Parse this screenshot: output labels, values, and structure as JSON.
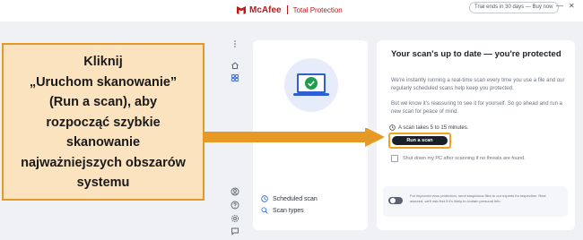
{
  "app": {
    "brand_name": "McAfee",
    "product_name": "Total Protection",
    "trial_text": "Trial ends in 30 days — Buy now",
    "brand_color": "#c01818"
  },
  "scan_card": {
    "heading": "Your scan's up to date — you're protected",
    "paragraph1": "We're instantly running a real-time scan every time you use a file and our regularly scheduled scans help keep you protected.",
    "paragraph2": "But we know it's reassuring to see it for yourself. So go ahead and run a new scan for peace of mind.",
    "duration": "A scan takes 5 to 15 minutes.",
    "run_button": "Run a scan",
    "shutdown_label": "Shut down my PC after scanning if no threats are found.",
    "privacy_text": "For improved virus protection, send suspicious files to our experts for inspection. Rest assured, we'll ask first if it's likely to contain personal info."
  },
  "left_card": {
    "scheduled_scan": "Scheduled scan",
    "scan_types": "Scan types"
  },
  "callout": {
    "lines": [
      "Kliknij",
      "„Uruchom skanowanie”",
      "(Run a scan), aby",
      "rozpocząć szybkie",
      "skanowanie",
      "najważniejszych obszarów",
      "systemu"
    ],
    "color": "#e69a25"
  },
  "icons": {
    "sidebar": [
      "more-icon",
      "home-icon",
      "grid-icon",
      "account-icon",
      "help-icon",
      "settings-icon",
      "feedback-icon"
    ]
  }
}
